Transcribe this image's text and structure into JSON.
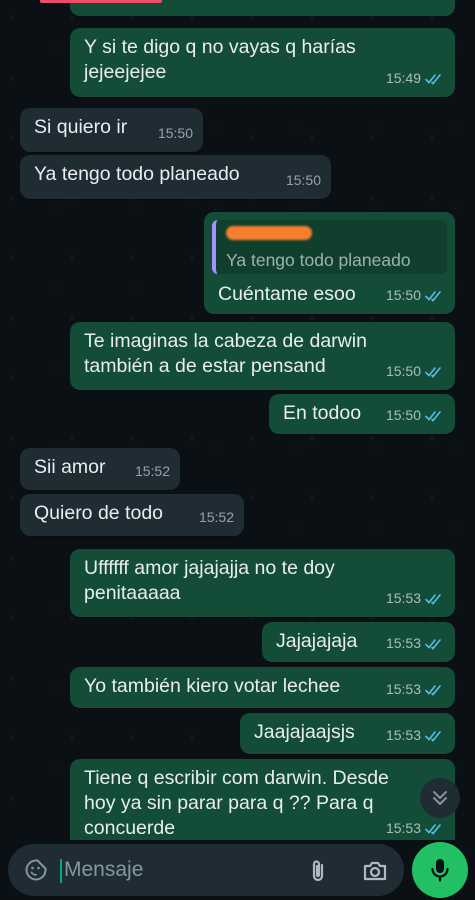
{
  "messages": [
    {
      "dir": "out",
      "text": "Y si te digo q no vayas q harías\njejeejejee",
      "time": "15:49",
      "read": true
    },
    {
      "dir": "in",
      "text": "Si quiero ir",
      "time": "15:50"
    },
    {
      "dir": "in",
      "text": "Ya tengo todo planeado",
      "time": "15:50"
    },
    {
      "dir": "out",
      "quote": "Ya tengo todo planeado",
      "text": "Cuéntame esoo",
      "time": "15:50",
      "read": true
    },
    {
      "dir": "out",
      "text": "Te imaginas la cabeza de darwin\ntambién a de estar pensand",
      "time": "15:50",
      "read": true
    },
    {
      "dir": "out",
      "text": "En todoo",
      "time": "15:50",
      "read": true
    },
    {
      "dir": "in",
      "text": "Sii amor",
      "time": "15:52"
    },
    {
      "dir": "in",
      "text": "Quiero de todo",
      "time": "15:52"
    },
    {
      "dir": "out",
      "text": "Uffffff amor jajajajja no te doy\npenitaaaaa",
      "time": "15:53",
      "read": true
    },
    {
      "dir": "out",
      "text": "Jajajajaja",
      "time": "15:53",
      "read": true
    },
    {
      "dir": "out",
      "text": "Yo también kiero votar lechee",
      "time": "15:53",
      "read": true
    },
    {
      "dir": "out",
      "text": "Jaajajaajsjs",
      "time": "15:53",
      "read": true
    },
    {
      "dir": "out",
      "text": "Tiene q escribir com darwin. Desde\nhoy ya sin parar para q ?? Para q\nconcuerde",
      "time": "15:53",
      "read": true
    }
  ],
  "composer": {
    "placeholder": "Mensaje"
  },
  "icons": {
    "emoji": "sticker-smiley-icon",
    "attach": "paperclip-icon",
    "camera": "camera-icon",
    "mic": "microphone-icon",
    "scroll": "double-chevron-down-icon",
    "read": "double-check-icon"
  },
  "colors": {
    "background": "#0b1014",
    "outgoing_bubble": "#144d37",
    "incoming_bubble": "#1f2c33",
    "read_ticks": "#53bdeb",
    "accent_green": "#21c063",
    "quote_bar": "#a791ff"
  }
}
